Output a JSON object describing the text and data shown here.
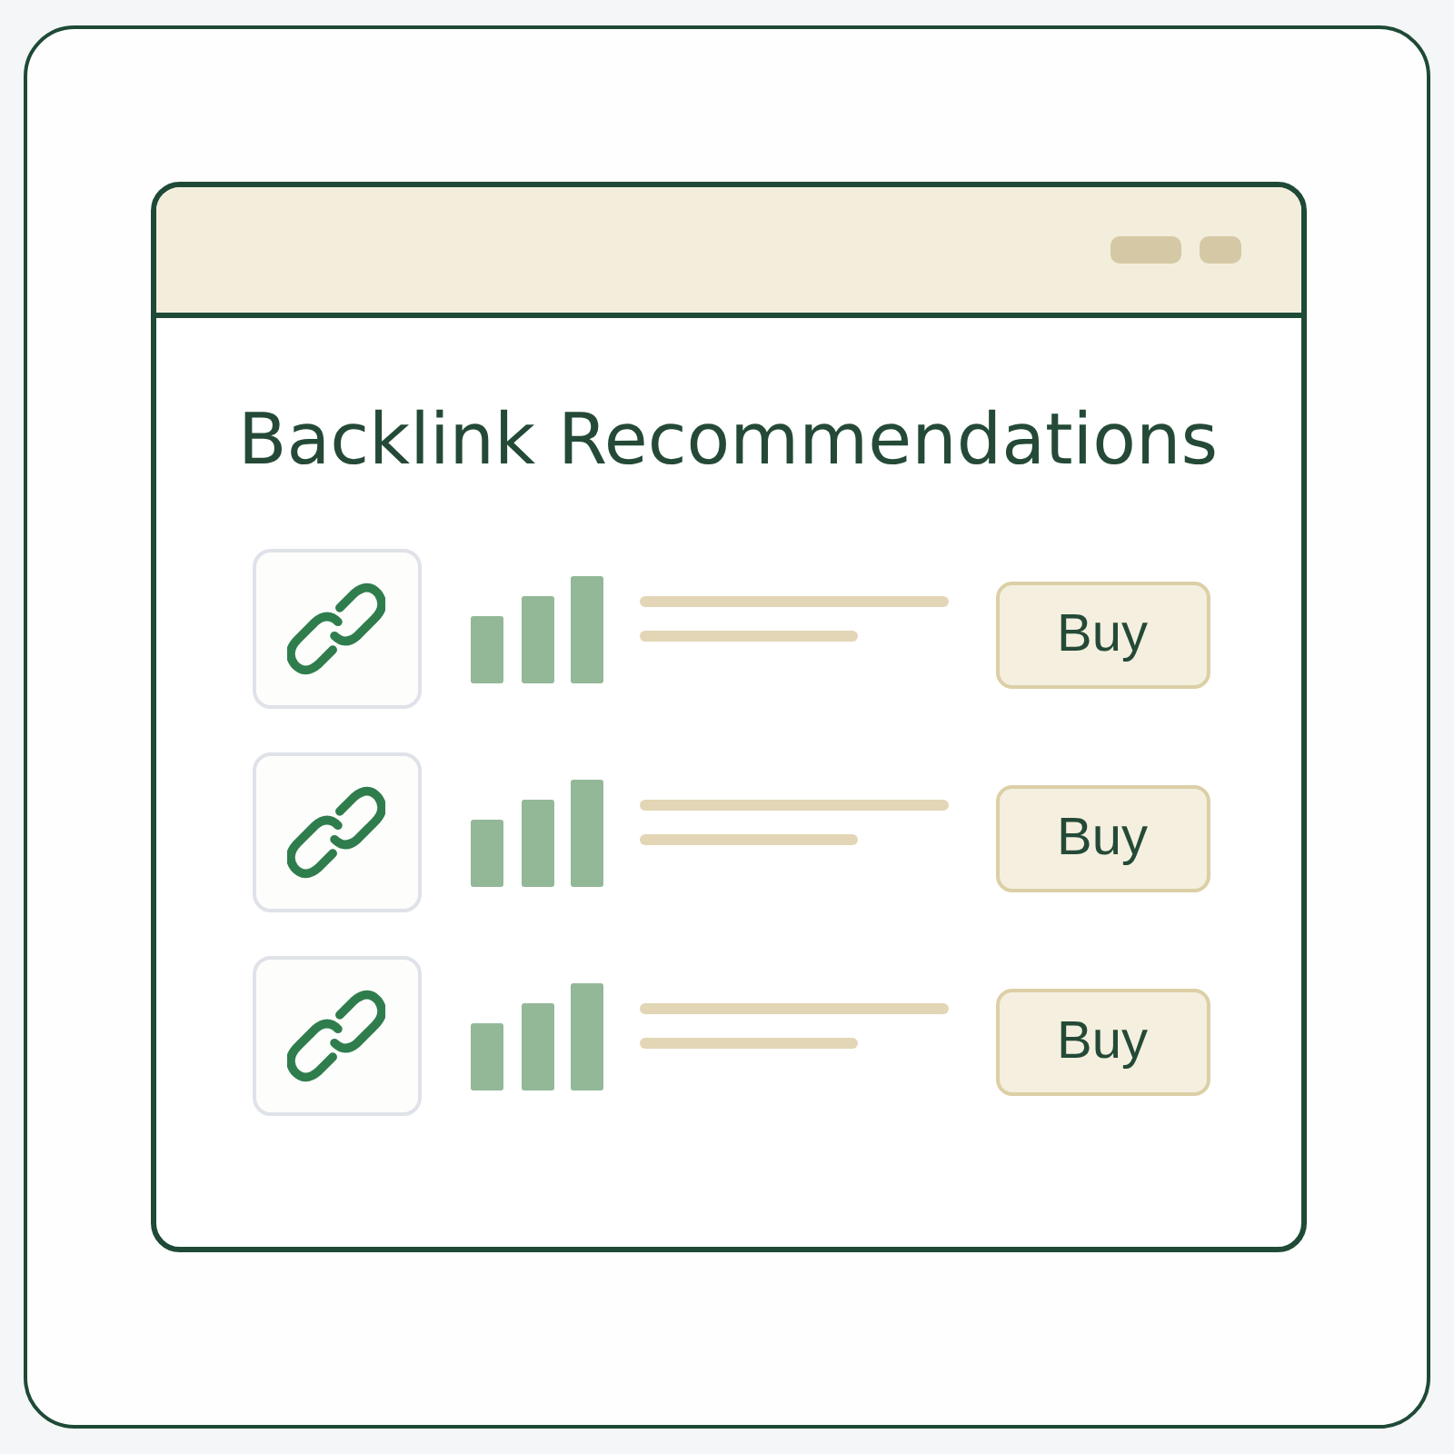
{
  "window": {
    "title": "Backlink Recommendations"
  },
  "rows": [
    {
      "button": "Buy"
    },
    {
      "button": "Buy"
    },
    {
      "button": "Buy"
    }
  ]
}
